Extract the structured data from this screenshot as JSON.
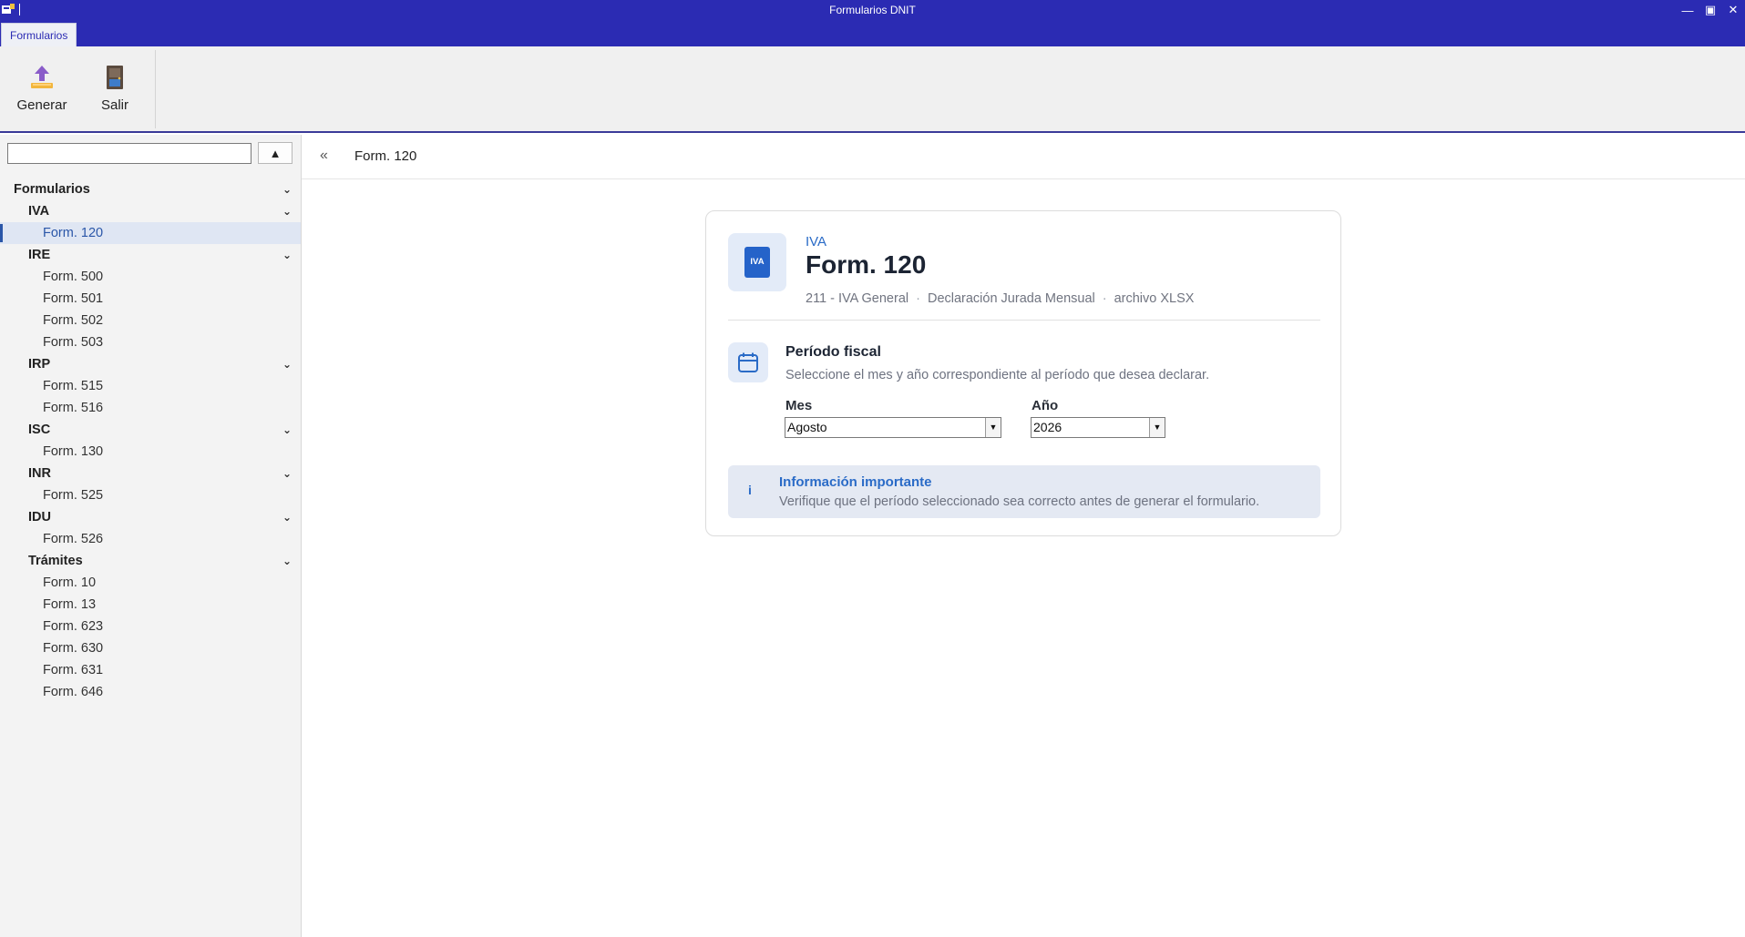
{
  "window": {
    "title": "Formularios DNIT",
    "controls": {
      "minimize": "—",
      "restore": "▣",
      "close": "✕"
    }
  },
  "ribbon": {
    "tab_label": "Formularios",
    "buttons": [
      {
        "label": "Generar",
        "icon": "upload-icon"
      },
      {
        "label": "Salir",
        "icon": "exit-door-icon"
      }
    ]
  },
  "sidebar": {
    "search": {
      "value": "",
      "placeholder": ""
    },
    "up_button": "▲",
    "tree": [
      {
        "label": "Formularios",
        "level": 0,
        "expandable": true
      },
      {
        "label": "IVA",
        "level": 1,
        "expandable": true
      },
      {
        "label": "Form. 120",
        "level": 2,
        "selected": true
      },
      {
        "label": "IRE",
        "level": 1,
        "expandable": true
      },
      {
        "label": "Form. 500",
        "level": 2
      },
      {
        "label": "Form. 501",
        "level": 2
      },
      {
        "label": "Form. 502",
        "level": 2
      },
      {
        "label": "Form. 503",
        "level": 2
      },
      {
        "label": "IRP",
        "level": 1,
        "expandable": true
      },
      {
        "label": "Form. 515",
        "level": 2
      },
      {
        "label": "Form. 516",
        "level": 2
      },
      {
        "label": "ISC",
        "level": 1,
        "expandable": true
      },
      {
        "label": "Form. 130",
        "level": 2
      },
      {
        "label": "INR",
        "level": 1,
        "expandable": true
      },
      {
        "label": "Form. 525",
        "level": 2
      },
      {
        "label": "IDU",
        "level": 1,
        "expandable": true
      },
      {
        "label": "Form. 526",
        "level": 2
      },
      {
        "label": "Trámites",
        "level": 1,
        "expandable": true
      },
      {
        "label": "Form. 10",
        "level": 2
      },
      {
        "label": "Form. 13",
        "level": 2
      },
      {
        "label": "Form. 623",
        "level": 2
      },
      {
        "label": "Form. 630",
        "level": 2
      },
      {
        "label": "Form. 631",
        "level": 2
      },
      {
        "label": "Form. 646",
        "level": 2
      }
    ]
  },
  "main": {
    "collapse_label": "«",
    "breadcrumb": "Form. 120",
    "card": {
      "badge_text": "IVA",
      "category": "IVA",
      "title": "Form. 120",
      "meta": [
        "211 - IVA General",
        "Declaración Jurada Mensual",
        "archivo XLSX"
      ],
      "meta_separator": "·",
      "period": {
        "title": "Período fiscal",
        "description": "Seleccione el mes y año correspondiente al período que desea declarar.",
        "month_label": "Mes",
        "month_value": "Agosto",
        "year_label": "Año",
        "year_value": "2026"
      },
      "info": {
        "icon": "i",
        "title": "Información importante",
        "text": "Verifique que el período seleccionado sea correcto antes de generar el formulario."
      }
    }
  },
  "colors": {
    "titlebar": "#2b2bb3",
    "accent": "#2a6bc7",
    "badge_bg": "#e3ebf8",
    "info_bg": "#e4e9f3"
  }
}
